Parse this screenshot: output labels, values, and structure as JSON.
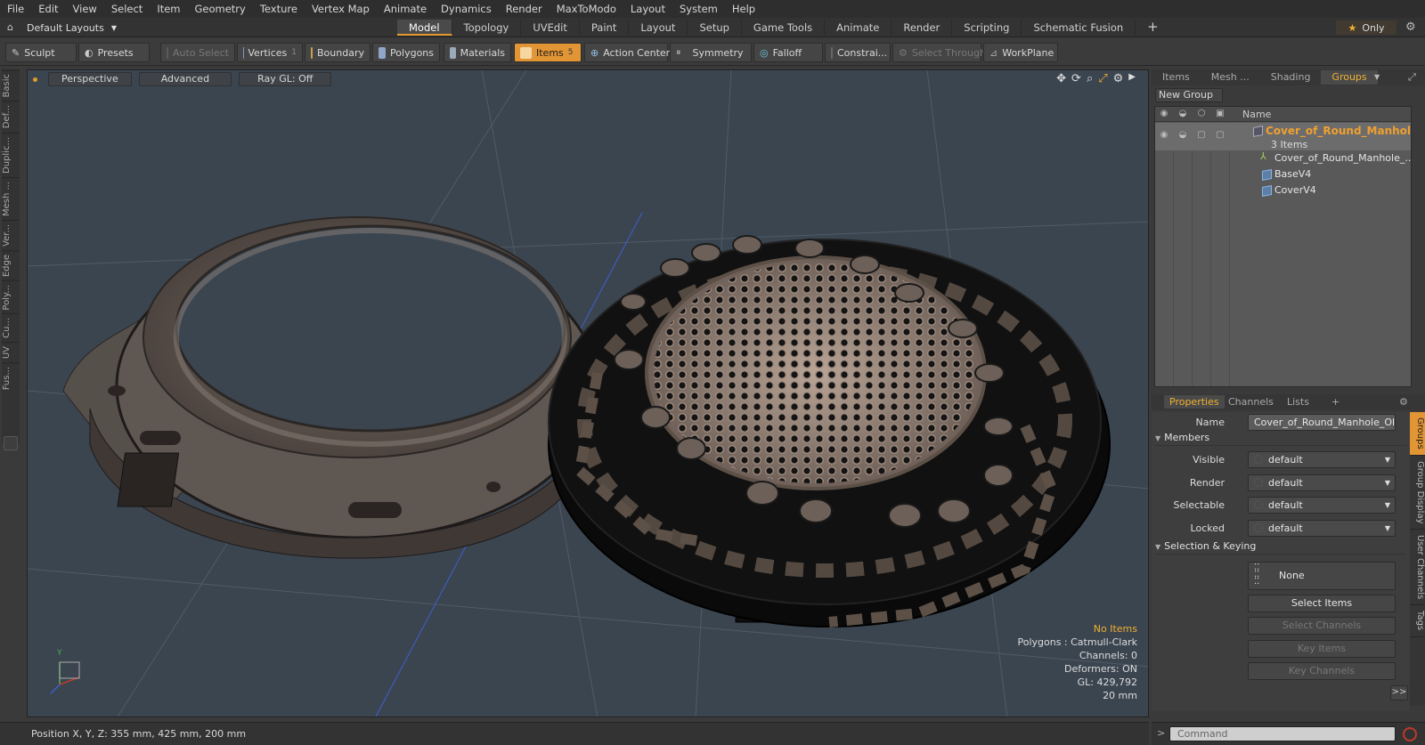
{
  "menubar": {
    "items": [
      "File",
      "Edit",
      "View",
      "Select",
      "Item",
      "Geometry",
      "Texture",
      "Vertex Map",
      "Animate",
      "Dynamics",
      "Render",
      "MaxToModo",
      "Layout",
      "System",
      "Help"
    ]
  },
  "layouts": {
    "label": "Default Layouts"
  },
  "tabs": {
    "items": [
      "Model",
      "Topology",
      "UVEdit",
      "Paint",
      "Layout",
      "Setup",
      "Game Tools",
      "Animate",
      "Render",
      "Scripting",
      "Schematic Fusion"
    ],
    "active": "Model",
    "add_label": "+"
  },
  "only_label": "Only",
  "toolbar": {
    "sculpt": "Sculpt",
    "presets": "Presets",
    "auto_select": "Auto Select",
    "vertices": "Vertices",
    "vertices_count": "1",
    "boundary": "Boundary",
    "polygons": "Polygons",
    "materials": "Materials",
    "items": "Items",
    "items_count": "5",
    "action_center": "Action Center",
    "symmetry": "Symmetry",
    "falloff": "Falloff",
    "constraints": "Constrai...",
    "select_through": "Select Through",
    "workplane": "WorkPlane"
  },
  "left_strip": [
    "Basic",
    "Def...",
    "Duplic...",
    "Mesh ...",
    "Ver...",
    "Edge",
    "Poly...",
    "Cu...",
    "UV",
    "Fus..."
  ],
  "viewport": {
    "view_label": "Perspective",
    "shading_label": "Advanced",
    "raygl_label": "Ray GL: Off",
    "info": {
      "selection": "No Items",
      "polygons": "Polygons : Catmull-Clark",
      "channels": "Channels: 0",
      "deformers": "Deformers: ON",
      "gl": "GL: 429,792",
      "scale": "20 mm"
    },
    "axis_y": "Y",
    "colors": {
      "background": "#3b4550",
      "grid": "#5a6570",
      "red_axis": "#c0392b",
      "blue_axis": "#3e5fd0",
      "highlight": "#f0b030"
    }
  },
  "status": {
    "position": "Position X, Y, Z:   355 mm, 425 mm, 200 mm"
  },
  "right_tabs": {
    "items": [
      "Items",
      "Mesh ...",
      "Shading",
      "Groups"
    ],
    "active": "Groups"
  },
  "groups": {
    "new_group": "New Group",
    "column_name": "Name",
    "group_name": "Cover_of_Round_Manhol ...",
    "group_count": "3 Items",
    "children": [
      "Cover_of_Round_Manhole_...",
      "BaseV4",
      "CoverV4"
    ]
  },
  "properties": {
    "tabs": [
      "Properties",
      "Channels",
      "Lists"
    ],
    "active": "Properties",
    "add_label": "+",
    "name_label": "Name",
    "name_value": "Cover_of_Round_Manhole_Old (:",
    "members_label": "Members",
    "visible_label": "Visible",
    "visible_value": "default",
    "render_label": "Render",
    "render_value": "default",
    "selectable_label": "Selectable",
    "selectable_value": "default",
    "locked_label": "Locked",
    "locked_value": "default",
    "selkey_label": "Selection & Keying",
    "none_label": "None",
    "select_items": "Select Items",
    "select_channels": "Select Channels",
    "key_items": "Key Items",
    "key_channels": "Key Channels",
    "more_label": ">>"
  },
  "side_tabs": [
    "Groups",
    "Group Display",
    "User Channels",
    "Tags"
  ],
  "command": {
    "placeholder": "Command",
    "prompt": ">"
  }
}
